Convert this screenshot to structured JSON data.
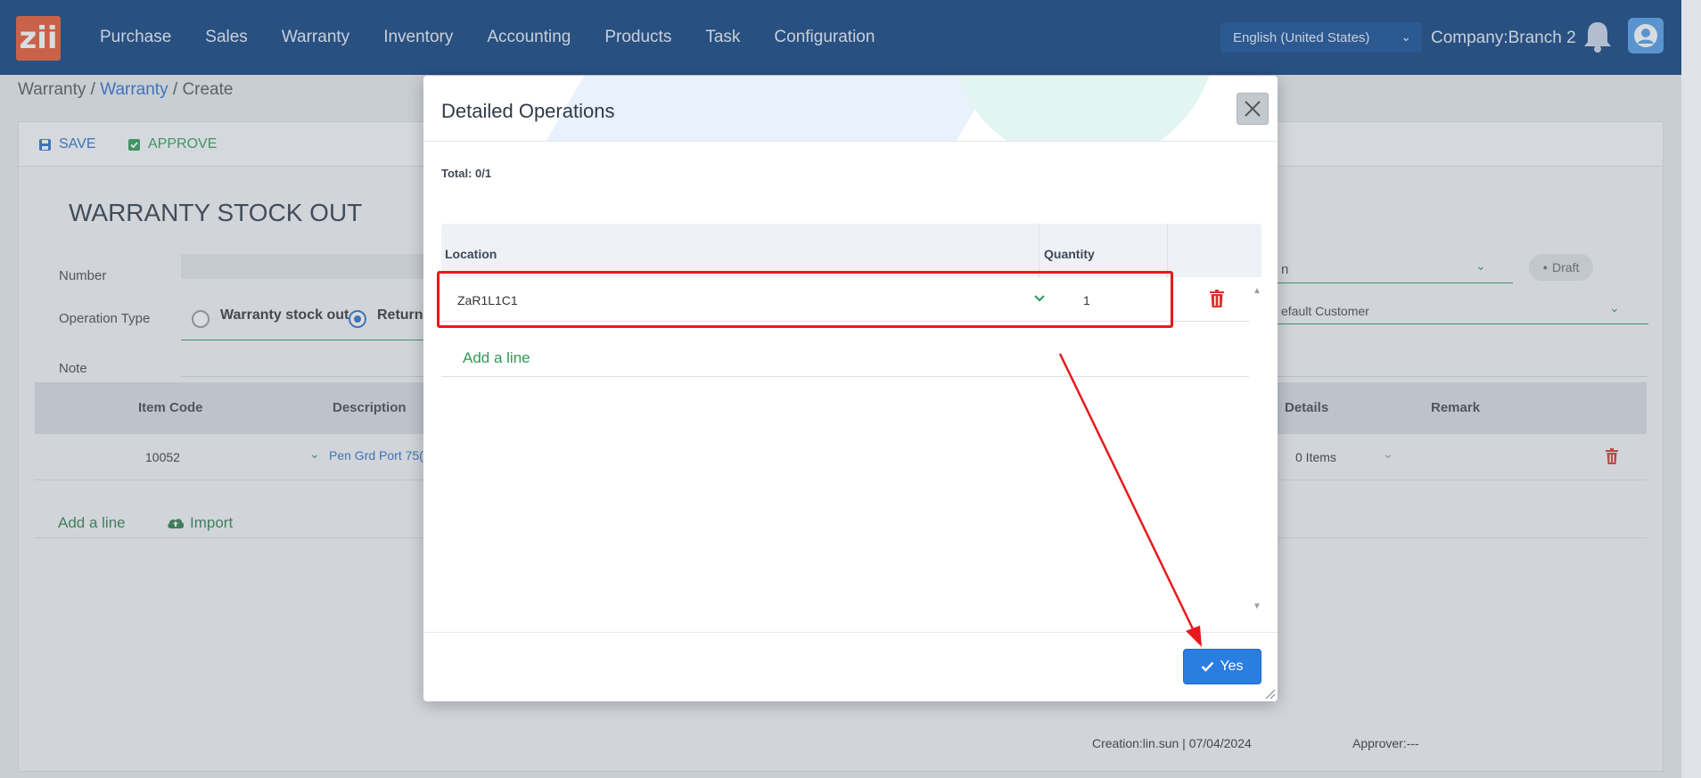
{
  "nav": {
    "logo": "zii",
    "items": [
      "Purchase",
      "Sales",
      "Warranty",
      "Inventory",
      "Accounting",
      "Products",
      "Task",
      "Configuration"
    ],
    "language": "English (United States)",
    "company": "Company:Branch 2"
  },
  "breadcrumb": {
    "root": "Warranty",
    "sep1": "/",
    "link": "Warranty",
    "sep2": "/",
    "current": "Create"
  },
  "toolbar": {
    "save": "SAVE",
    "approve": "APPROVE"
  },
  "form": {
    "title": "WARRANTY STOCK OUT",
    "number_label": "Number",
    "operation_type_label": "Operation Type",
    "option_warranty": "Warranty stock out",
    "option_return": "Return",
    "note_label": "Note",
    "right_field_partial": "n",
    "status": "Draft",
    "customer_partial": "efault Customer"
  },
  "grid": {
    "headers": [
      "Item Code",
      "Description",
      "Details",
      "Remark"
    ],
    "row": {
      "item_code": "10052",
      "description": "Pen Grd Port 75(",
      "details": "0 Items"
    },
    "add_line": "Add a line",
    "import": "Import"
  },
  "footer": {
    "creation": "Creation:lin.sun | 07/04/2024",
    "approver": "Approver:---"
  },
  "modal": {
    "title": "Detailed Operations",
    "total": "Total: 0/1",
    "col_location": "Location",
    "col_quantity": "Quantity",
    "row": {
      "location": "ZaR1L1C1",
      "quantity": "1"
    },
    "add_line": "Add a line",
    "yes": "Yes"
  },
  "colors": {
    "nav_bg": "#0b3d7c",
    "accent_blue": "#2a7de1",
    "accent_green": "#2c9a56",
    "highlight_red": "#e8191c"
  }
}
